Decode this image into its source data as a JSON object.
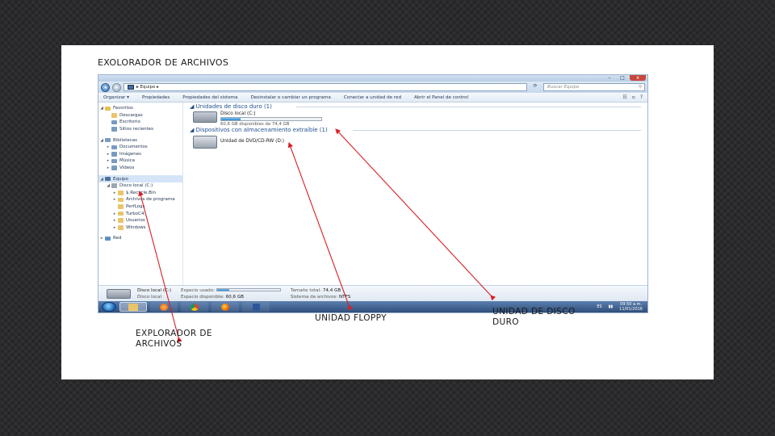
{
  "slide": {
    "title": "EXOLORADOR DE ARCHIVOS",
    "annotations": {
      "explorer": [
        "EXPLORADOR DE",
        "ARCHIVOS"
      ],
      "floppy": "UNIDAD FLOPPY",
      "hard_disk": [
        "UNIDAD DE DISCO",
        "DURO"
      ]
    }
  },
  "window": {
    "controls": {
      "minimize": "–",
      "maximize": "□",
      "close": "x"
    },
    "address": {
      "text": "▸ Equipo ▸",
      "refresh_icon": "refresh-icon"
    },
    "search": {
      "placeholder": "Buscar Equipo",
      "icon": "search-icon"
    },
    "toolbar": {
      "organize": "Organizar ▾",
      "properties": "Propiedades",
      "system_properties": "Propiedades del sistema",
      "uninstall": "Desinstalar o cambiar un programa",
      "map_drive": "Conectar a unidad de red",
      "control_panel": "Abrir el Panel de control",
      "view": "☷",
      "preview": "▫",
      "help": "?"
    },
    "nav": {
      "favorites": "Favoritos",
      "downloads": "Descargas",
      "desktop": "Escritorio",
      "recent": "Sitios recientes",
      "libraries": "Bibliotecas",
      "documents": "Documentos",
      "images": "Imágenes",
      "music": "Música",
      "videos": "Vídeos",
      "computer": "Equipo",
      "local_disk": "Disco local (C:)",
      "folder1": "$.Recycle.Bin",
      "folder2": "Archivos de programa",
      "folder3": "PerfLogs",
      "folder4": "TurboC4",
      "folder5": "Usuarios",
      "folder6": "Windows",
      "network": "Red"
    },
    "content": {
      "hdd_group": "Unidades de disco duro (1)",
      "hdd_name": "Disco local (C:)",
      "hdd_free": "60,6 GB disponibles de 74,4 GB",
      "hdd_used_fraction": 0.19,
      "removable_group": "Dispositivos con almacenamiento extraíble (1)",
      "dvd_name": "Unidad de DVD/CD-RW (D:)"
    },
    "details": {
      "name": "Disco local (C:)",
      "type": "Disco local",
      "used_label": "Espacio usado:",
      "free_label": "Espacio disponible:",
      "free_value": "60,6 GB",
      "total_label": "Tamaño total:",
      "total_value": "74,4 GB",
      "fs_label": "Sistema de archivos:",
      "fs_value": "NTFS",
      "used_fraction": 0.19
    },
    "taskbar": {
      "lang": "ES",
      "time": "09:50 a.m.",
      "date": "11/01/2016"
    }
  },
  "colors": {
    "arrow": "#d81f26",
    "accent": "#1e4f8c"
  }
}
